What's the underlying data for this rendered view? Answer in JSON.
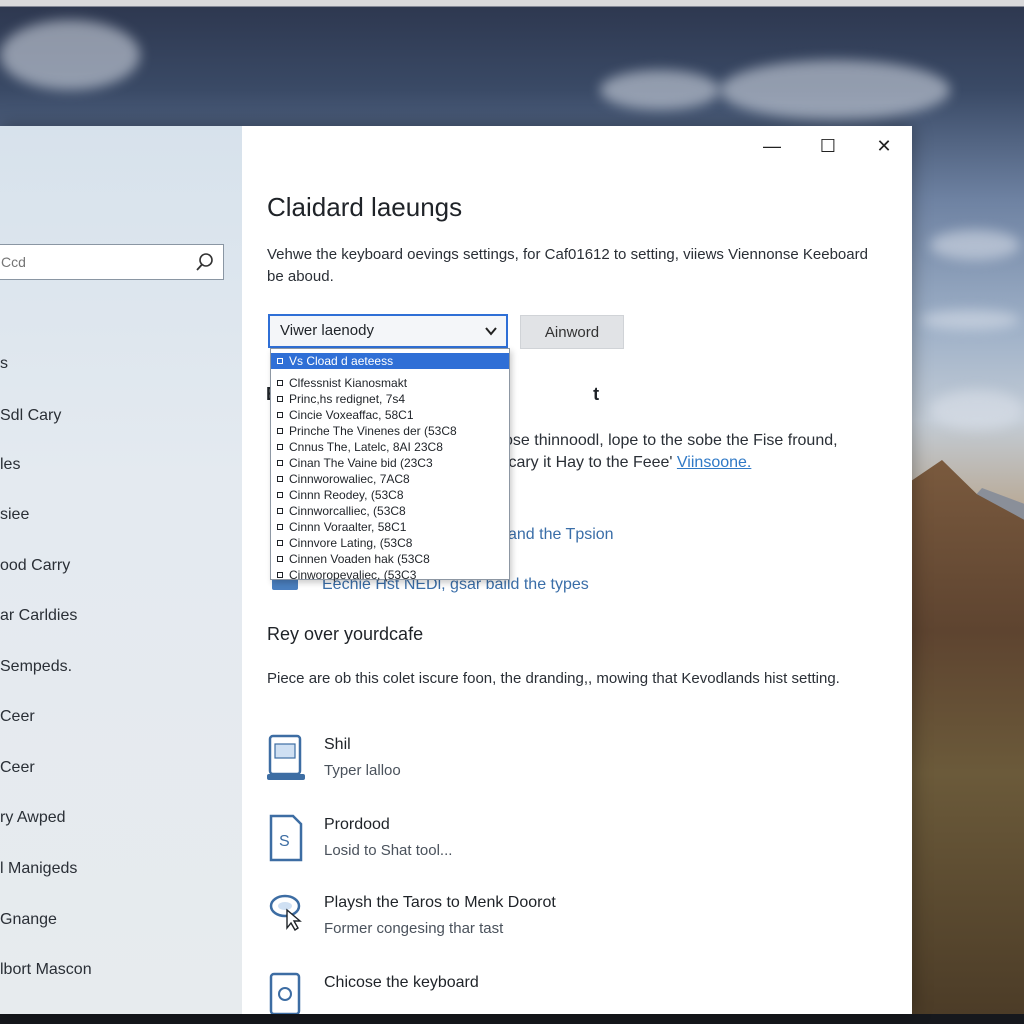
{
  "window": {
    "title": "Claidard laeungs",
    "description": "Vehwe the keyboard oevings settings, for Caf01612 to setting, viiews Viennonse Keeboard be aboud.",
    "controls": {
      "minimize": "—",
      "maximize": "☐",
      "close": "✕"
    }
  },
  "sidebar": {
    "search": {
      "placeholder": "Ccd"
    },
    "items": [
      "s",
      "Sdl Cary",
      "les",
      "siee",
      "ood Carry",
      "ar Carldies",
      "Sempeds.",
      "Ceer",
      "Ceer",
      "ry Awped",
      "l Manigeds",
      "Gnange",
      "lbort Mascon"
    ]
  },
  "main": {
    "select": {
      "value": "Viwer laenody"
    },
    "secondary_button": "Ainword",
    "dropdown": {
      "selected": "Vs Cload d aeteess",
      "items": [
        "Clfessnist Kianosmakt",
        "Princ,hs redignet,  7s4",
        "Cincie Voxeaffac,  58C1",
        "Prinche The Vinenes der  (53C8",
        "Cnnus The, Latelc,  8AI  23C8",
        "Cinan The Vaine bid  (23C3",
        "Cinnworowaliec,  7AC8",
        "Cinnn Reodey,  (53C8",
        "Cinnworcalliec,  (53C8",
        "Cinnn Voraalter,  58C1",
        "Cinnvore Lating,  (53C8",
        "Cinnen Voaden hak  (53C8",
        "Cinworopevaliec,  (53C3"
      ]
    },
    "partial_lines": {
      "line1": "ose thinnoodl, lope to the sobe the  Fise fround,",
      "line2_prefix": "tcary it Hay to the Feee'",
      "line2_link": "Viinsoone.",
      "line3": "and the Tpsion"
    },
    "blue_line": "Eechie Hst NEDl, gsar baild the types",
    "section": {
      "heading": "Rey over yourdcafe",
      "description": "Piece are ob this colet iscure foon, the dranding,, mowing that Kevodlands hist setting."
    },
    "items": [
      {
        "title": "Shil",
        "subtitle": "Typer lalloo"
      },
      {
        "title": "Prordood",
        "subtitle": "Losid to Shat tool..."
      },
      {
        "title": "Playsh the Taros to Menk Doorot",
        "subtitle": "Former congesing thar tast"
      },
      {
        "title": "Chicose the keyboard",
        "subtitle": ""
      }
    ]
  },
  "colors": {
    "accent": "#2f6fd6",
    "link": "#2f79c6",
    "sidebar_bg": "#dfe6ed",
    "content_bg": "#ffffff"
  }
}
